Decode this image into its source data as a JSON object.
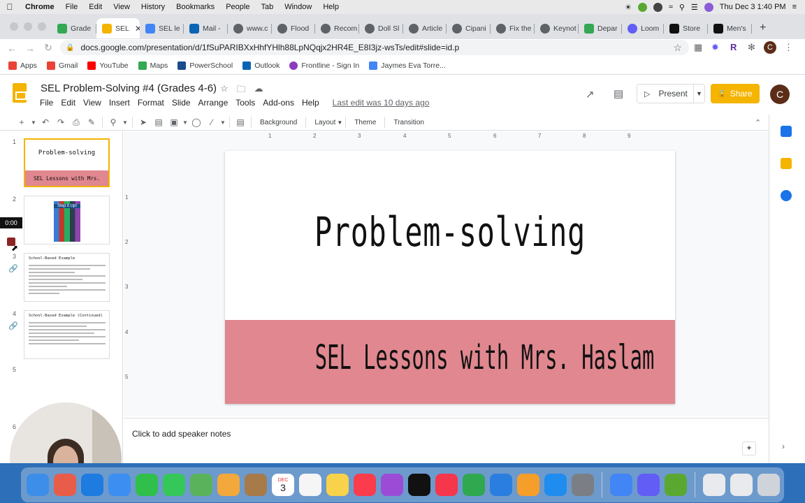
{
  "menubar": {
    "apple": "",
    "items": [
      "Chrome",
      "File",
      "Edit",
      "View",
      "History",
      "Bookmarks",
      "People",
      "Tab",
      "Window",
      "Help"
    ],
    "clock": "Thu Dec 3  1:40 PM"
  },
  "browser": {
    "tabs": [
      {
        "label": "Grade",
        "color": "#34a853"
      },
      {
        "label": "SEL",
        "color": "#f4b400"
      },
      {
        "label": "SEL le",
        "color": "#4285f4"
      },
      {
        "label": "Mail -",
        "color": "#0a64b4"
      },
      {
        "label": "www.c",
        "color": "#5f6368"
      },
      {
        "label": "Flood",
        "color": "#5f6368"
      },
      {
        "label": "Recom",
        "color": "#5f6368"
      },
      {
        "label": "Doll Sl",
        "color": "#5f6368"
      },
      {
        "label": "Article",
        "color": "#5f6368"
      },
      {
        "label": "Cipani",
        "color": "#5f6368"
      },
      {
        "label": "Fix the",
        "color": "#5f6368"
      },
      {
        "label": "Keynot",
        "color": "#5f6368"
      },
      {
        "label": "Depar",
        "color": "#34a853"
      },
      {
        "label": "Loom",
        "color": "#625df5"
      },
      {
        "label": "Store",
        "color": "#111111"
      },
      {
        "label": "Men's",
        "color": "#111111"
      }
    ],
    "url": "docs.google.com/presentation/d/1fSuPARIBXxHhfYHlh88LpNQqjx2HR4E_E8I3jz-wsTs/edit#slide=id.p",
    "profile_initial": "C"
  },
  "bookmarks": [
    {
      "label": "Apps",
      "color": "#5f6368"
    },
    {
      "label": "Gmail",
      "color": "#ea4335"
    },
    {
      "label": "YouTube",
      "color": "#ff0000"
    },
    {
      "label": "Maps",
      "color": "#34a853"
    },
    {
      "label": "PowerSchool",
      "color": "#1a4c8b"
    },
    {
      "label": "Outlook",
      "color": "#0a64b4"
    },
    {
      "label": "Frontline - Sign In",
      "color": "#8e3bbf"
    },
    {
      "label": "Jaymes Eva Torre...",
      "color": "#4285f4"
    }
  ],
  "slides_app": {
    "title": "SEL Problem-Solving #4 (Grades 4-6)",
    "menu": [
      "File",
      "Edit",
      "View",
      "Insert",
      "Format",
      "Slide",
      "Arrange",
      "Tools",
      "Add-ons",
      "Help"
    ],
    "last_edit": "Last edit was 10 days ago",
    "present_label": "Present",
    "share_label": "Share",
    "avatar_initial": "C",
    "toolbar_text": [
      "Background",
      "Layout",
      "Theme",
      "Transition"
    ],
    "brand_color": "#f4b400"
  },
  "filmstrip": {
    "numbers": [
      "1",
      "2",
      "3",
      "4",
      "5",
      "6"
    ],
    "slide1_title": "Problem-solving",
    "slide1_sub": "SEL Lessons with Mrs. Haslam",
    "slide2_caption": "Step it Up!",
    "slide3_title": "School-Based Example",
    "slide4_title": "School-Based Example (Continued)",
    "timer": "0:00"
  },
  "slide": {
    "title": "Problem-solving",
    "subtitle": "SEL Lessons with Mrs. Haslam",
    "band_color": "#e0878f"
  },
  "ruler": {
    "top": [
      "1",
      "2",
      "3",
      "4",
      "5",
      "6",
      "7",
      "8",
      "9"
    ],
    "left": [
      "1",
      "2",
      "3",
      "4",
      "5"
    ]
  },
  "notes": {
    "placeholder": "Click to add speaker notes"
  },
  "dock": {
    "apps": [
      {
        "name": "Finder",
        "color": "#3d8ee8"
      },
      {
        "name": "Launchpad",
        "color": "#e85d4a"
      },
      {
        "name": "Safari",
        "color": "#1e7be0"
      },
      {
        "name": "Mail",
        "color": "#3c8ef0"
      },
      {
        "name": "FaceTime",
        "color": "#2fbf4a"
      },
      {
        "name": "Messages",
        "color": "#35c759"
      },
      {
        "name": "Maps",
        "color": "#5ab35a"
      },
      {
        "name": "Photos",
        "color": "#f2a83a"
      },
      {
        "name": "Contacts",
        "color": "#a77a4a"
      },
      {
        "name": "Calendar",
        "color": "#ffffff"
      },
      {
        "name": "Reminders",
        "color": "#f5f5f5"
      },
      {
        "name": "Notes",
        "color": "#f7d24a"
      },
      {
        "name": "Music",
        "color": "#fa3c4c"
      },
      {
        "name": "Podcasts",
        "color": "#9b4bd6"
      },
      {
        "name": "TV",
        "color": "#111111"
      },
      {
        "name": "News",
        "color": "#f5364b"
      },
      {
        "name": "Numbers",
        "color": "#2fa84f"
      },
      {
        "name": "Keynote",
        "color": "#2a7ee0"
      },
      {
        "name": "Pages",
        "color": "#f59e2a"
      },
      {
        "name": "App Store",
        "color": "#1f8cf0"
      },
      {
        "name": "System Preferences",
        "color": "#7b7f85"
      },
      {
        "name": "Chrome",
        "color": "#4285f4"
      },
      {
        "name": "Loom",
        "color": "#625df5"
      },
      {
        "name": "Word",
        "color": "#5aa832"
      }
    ],
    "calendar_day": "3",
    "calendar_month": "DEC"
  }
}
